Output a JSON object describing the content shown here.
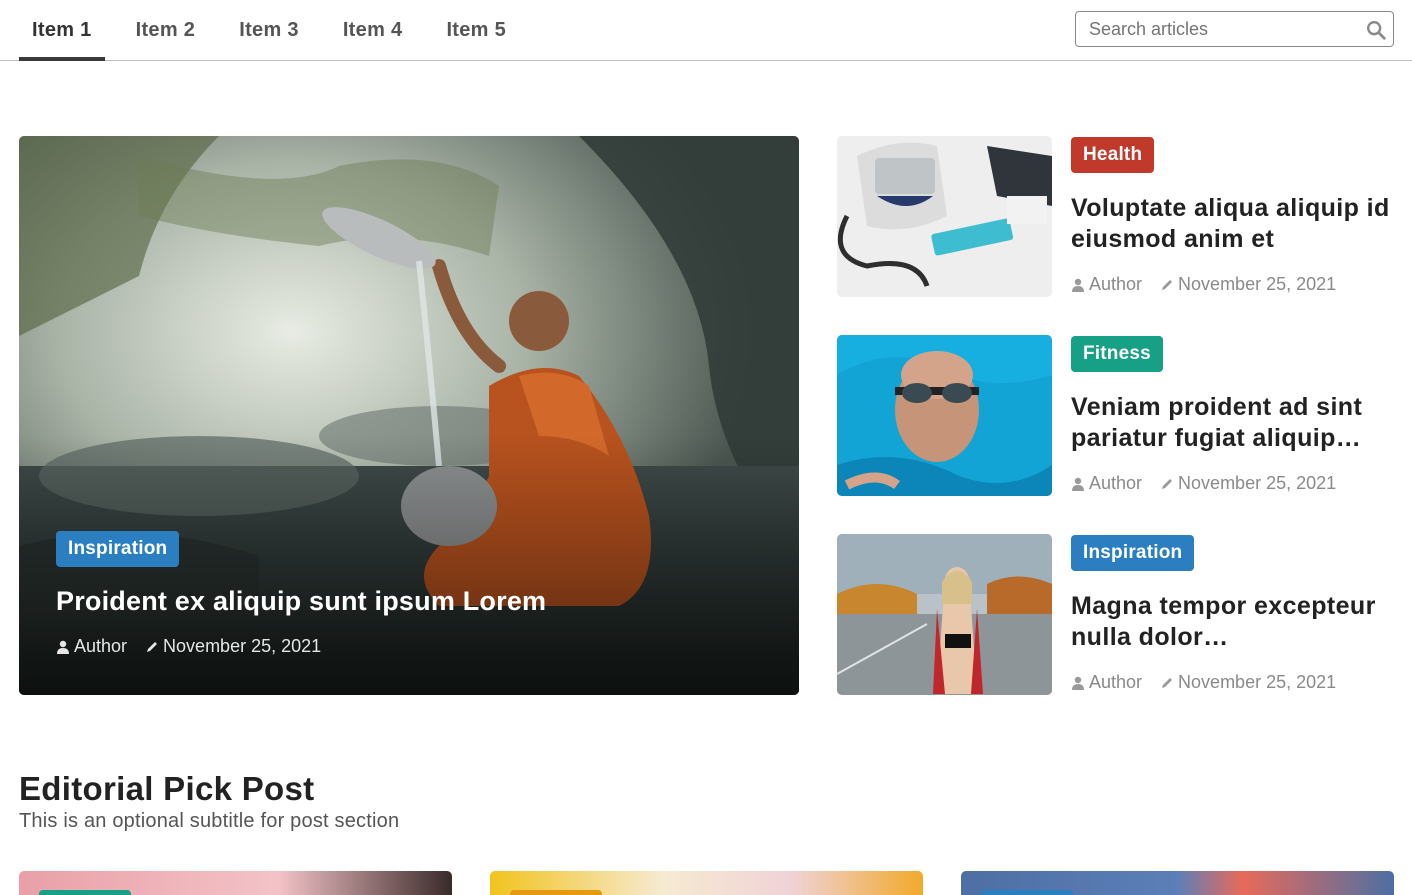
{
  "nav": {
    "tabs": [
      {
        "label": "Item 1",
        "active": true
      },
      {
        "label": "Item 2",
        "active": false
      },
      {
        "label": "Item 3",
        "active": false
      },
      {
        "label": "Item 4",
        "active": false
      },
      {
        "label": "Item 5",
        "active": false
      }
    ],
    "search": {
      "placeholder": "Search articles",
      "value": "",
      "icon": "search-icon"
    }
  },
  "hero": {
    "category": "Inspiration",
    "category_color": "#2b7fc1",
    "title": "Proident ex aliquip sunt ipsum Lorem",
    "author": "Author",
    "date": "November 25, 2021"
  },
  "side_posts": [
    {
      "category": "Health",
      "category_color": "#c0392b",
      "title": "Voluptate aliqua aliquip id eiusmod anim et",
      "author": "Author",
      "date": "November 25, 2021"
    },
    {
      "category": "Fitness",
      "category_color": "#16a085",
      "title": "Veniam proident ad sint pariatur fugiat aliquip…",
      "author": "Author",
      "date": "November 25, 2021"
    },
    {
      "category": "Inspiration",
      "category_color": "#2b7fc1",
      "title": "Magna tempor excepteur nulla dolor…",
      "author": "Author",
      "date": "November 25, 2021"
    }
  ],
  "editorial": {
    "title": "Editorial Pick Post",
    "subtitle": "This is an optional subtitle for post section"
  }
}
